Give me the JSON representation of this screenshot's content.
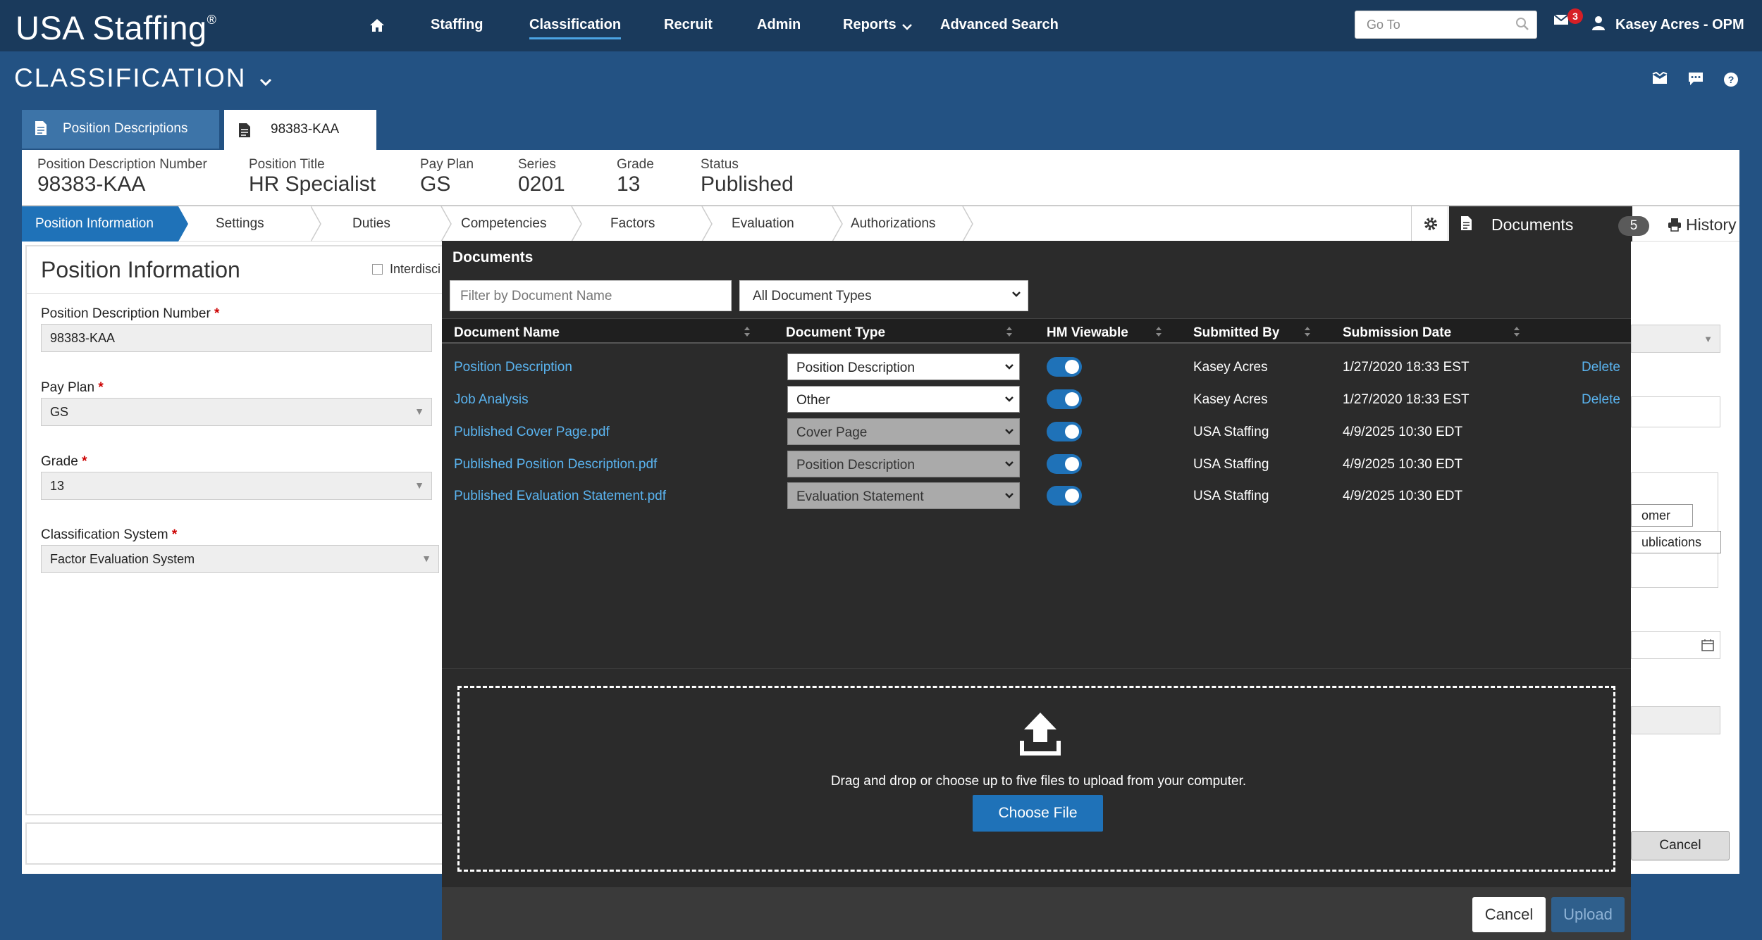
{
  "header": {
    "logo": "USA Staffing",
    "logo_reg": "®",
    "nav": [
      "Staffing",
      "Classification",
      "Recruit",
      "Admin",
      "Reports",
      "Advanced Search"
    ],
    "goto_placeholder": "Go To",
    "mail_count": "3",
    "user": "Kasey Acres - OPM"
  },
  "module": {
    "title": "CLASSIFICATION"
  },
  "tabs": [
    {
      "label": "Position Descriptions",
      "active": false
    },
    {
      "label": "98383-KAA",
      "active": true
    }
  ],
  "summary": [
    {
      "label": "Position Description Number",
      "value": "98383-KAA"
    },
    {
      "label": "Position Title",
      "value": "HR Specialist"
    },
    {
      "label": "Pay Plan",
      "value": "GS"
    },
    {
      "label": "Series",
      "value": "0201"
    },
    {
      "label": "Grade",
      "value": "13"
    },
    {
      "label": "Status",
      "value": "Published"
    }
  ],
  "steps": [
    "Position Information",
    "Settings",
    "Duties",
    "Competencies",
    "Factors",
    "Evaluation",
    "Authorizations"
  ],
  "side_buttons": {
    "documents": "Documents",
    "documents_count": "5",
    "history": "History"
  },
  "position_info": {
    "title": "Position Information",
    "interdisc": "Interdisci",
    "fields": [
      {
        "label": "Position Description Number",
        "value": "98383-KAA"
      },
      {
        "label": "Pay Plan",
        "value": "GS"
      },
      {
        "label": "Grade",
        "value": "13"
      },
      {
        "label": "Classification System",
        "value": "Factor Evaluation System"
      }
    ]
  },
  "background_right": {
    "btn1": "omer",
    "btn2": "ublications",
    "cancel": "Cancel"
  },
  "modal": {
    "title": "Documents",
    "filter_placeholder": "Filter by Document Name",
    "type_filter": "All Document Types",
    "columns": [
      "Document Name",
      "Document Type",
      "HM Viewable",
      "Submitted By",
      "Submission Date"
    ],
    "rows": [
      {
        "name": "Position Description",
        "type": "Position Description",
        "editable": true,
        "hm_viewable": true,
        "submitted_by": "Kasey Acres",
        "date": "1/27/2020 18:33 EST",
        "action": "Delete"
      },
      {
        "name": "Job Analysis",
        "type": "Other",
        "editable": true,
        "hm_viewable": true,
        "submitted_by": "Kasey Acres",
        "date": "1/27/2020 18:33 EST",
        "action": "Delete"
      },
      {
        "name": "Published Cover Page.pdf",
        "type": "Cover Page",
        "editable": false,
        "hm_viewable": true,
        "submitted_by": "USA Staffing",
        "date": "4/9/2025 10:30 EDT",
        "action": ""
      },
      {
        "name": "Published Position Description.pdf",
        "type": "Position Description",
        "editable": false,
        "hm_viewable": true,
        "submitted_by": "USA Staffing",
        "date": "4/9/2025 10:30 EDT",
        "action": ""
      },
      {
        "name": "Published Evaluation Statement.pdf",
        "type": "Evaluation Statement",
        "editable": false,
        "hm_viewable": true,
        "submitted_by": "USA Staffing",
        "date": "4/9/2025 10:30 EDT",
        "action": ""
      }
    ],
    "dropzone_text": "Drag and drop or choose up to five files to upload from your computer.",
    "choose_file": "Choose File",
    "cancel": "Cancel",
    "upload": "Upload"
  },
  "colors": {
    "nav_bg": "#1a3a5c",
    "page_bg": "#235283",
    "accent": "#1f72b8",
    "modal_bg": "#2b2b2b",
    "link": "#5ab4f0"
  }
}
